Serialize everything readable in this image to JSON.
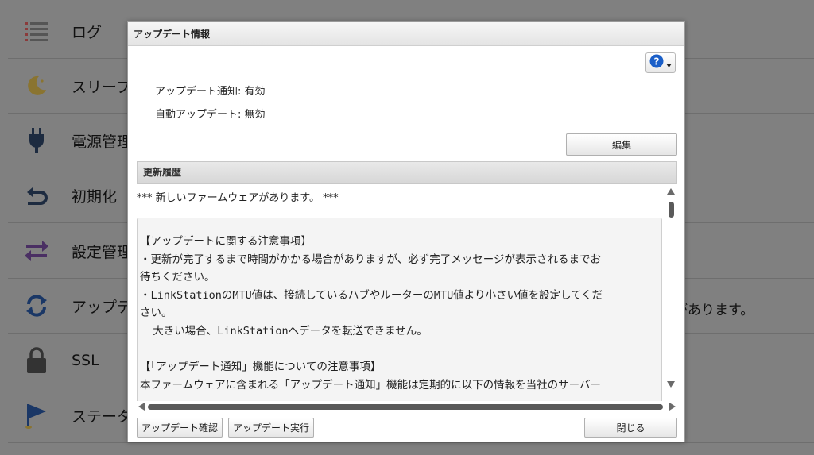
{
  "background": {
    "items": [
      {
        "label": "ログ",
        "icon": "log-list-icon"
      },
      {
        "label": "スリープ",
        "icon": "sleep-moon-icon"
      },
      {
        "label": "電源管理",
        "icon": "power-plug-icon"
      },
      {
        "label": "初期化",
        "icon": "reset-arrow-icon"
      },
      {
        "label": "設定管理",
        "icon": "settings-transfer-icon"
      },
      {
        "label": "アップデ",
        "icon": "update-refresh-icon"
      },
      {
        "label": "SSL",
        "icon": "lock-icon"
      },
      {
        "label": "ステータ",
        "icon": "status-flag-icon"
      }
    ],
    "right_text": "があります。"
  },
  "dialog": {
    "title": "アップデート情報",
    "notify_line": "アップデート通知: 有効",
    "auto_line": "自動アップデート: 無効",
    "edit_label": "編集",
    "history_header": "更新履歴",
    "history_first": "*** 新しいファームウェアがあります。 ***",
    "notice_lines": [
      "【アップデートに関する注意事項】",
      "・更新が完了するまで時間がかかる場合がありますが、必ず完了メッセージが表示されるまでお",
      "待ちください。",
      "・LinkStationのMTU値は、接続しているハブやルーターのMTU値より小さい値を設定してくだ",
      "さい。",
      "  大きい場合、LinkStationへデータを転送できません。",
      "",
      "【「アップデート通知」機能についての注意事項】",
      "本ファームウェアに含まれる「アップデート通知」機能は定期的に以下の情報を当社のサーバー"
    ],
    "check_label": "アップデート確認",
    "run_label": "アップデート実行",
    "close_label": "閉じる"
  },
  "colors": {
    "help_blue": "#1a5fc8",
    "overlay_gray": "#808080"
  }
}
